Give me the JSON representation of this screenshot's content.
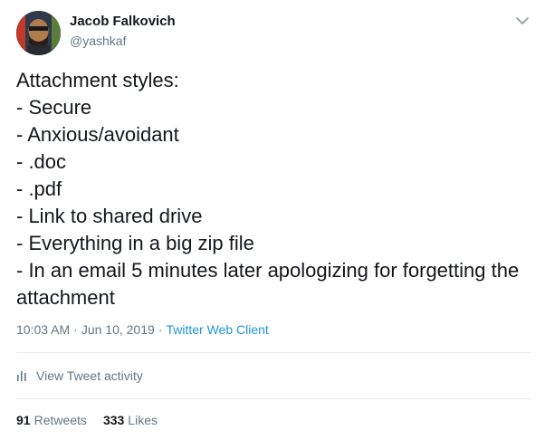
{
  "author": {
    "display_name": "Jacob Falkovich",
    "handle": "@yashkaf"
  },
  "tweet": {
    "lines": [
      "Attachment styles:",
      "- Secure",
      "- Anxious/avoidant",
      "- .doc",
      "- .pdf",
      "- Link to shared drive",
      "- Everything in a big zip file",
      "- In an email 5 minutes later apologizing for forgetting the attachment"
    ]
  },
  "meta": {
    "time": "10:03 AM",
    "separator": "·",
    "date": "Jun 10, 2019",
    "client": "Twitter Web Client"
  },
  "activity": {
    "label": "View Tweet activity",
    "icon": "bar-chart-icon"
  },
  "stats": {
    "retweets_count": "91",
    "retweets_label": "Retweets",
    "likes_count": "333",
    "likes_label": "Likes"
  },
  "colors": {
    "text": "#14171a",
    "secondary": "#657786",
    "link": "#1b95e0",
    "divider": "#e6ecf0"
  }
}
